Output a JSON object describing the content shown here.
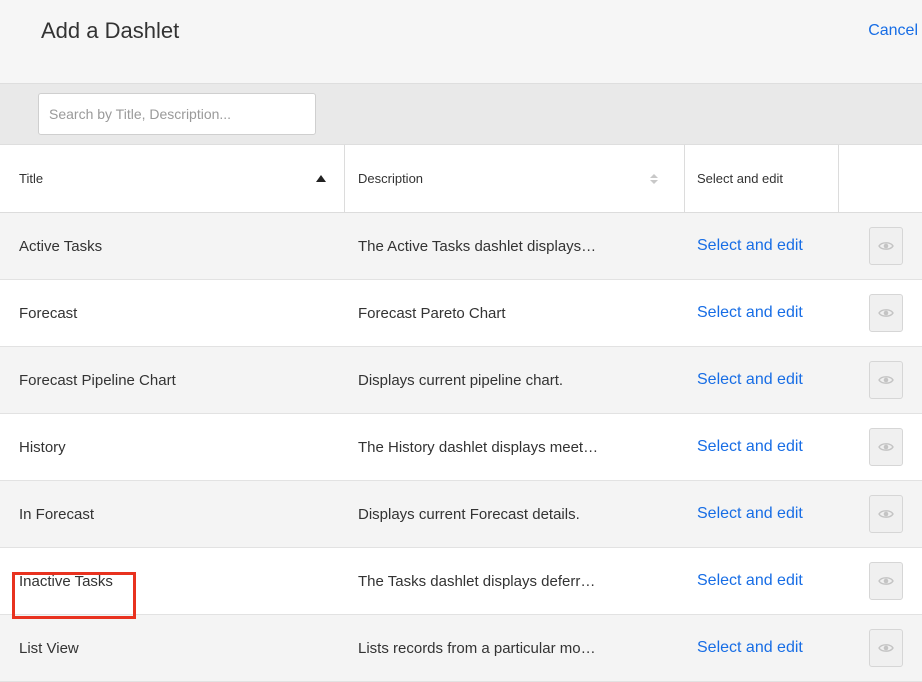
{
  "header": {
    "title": "Add a Dashlet",
    "cancel_label": "Cancel"
  },
  "search": {
    "placeholder": "Search by Title, Description..."
  },
  "table": {
    "columns": {
      "title": "Title",
      "description": "Description",
      "select": "Select and edit"
    },
    "sort": {
      "column": "title",
      "direction": "ascending"
    },
    "rows": [
      {
        "title": "Active Tasks",
        "description": "The Active Tasks dashlet displays…",
        "action": "Select and edit"
      },
      {
        "title": "Forecast",
        "description": "Forecast Pareto Chart",
        "action": "Select and edit"
      },
      {
        "title": "Forecast Pipeline Chart",
        "description": "Displays current pipeline chart.",
        "action": "Select and edit"
      },
      {
        "title": "History",
        "description": "The History dashlet displays meet…",
        "action": "Select and edit"
      },
      {
        "title": "In Forecast",
        "description": "Displays current Forecast details.",
        "action": "Select and edit"
      },
      {
        "title": "Inactive Tasks",
        "description": "The Tasks dashlet displays deferr…",
        "action": "Select and edit"
      },
      {
        "title": "List View",
        "description": "Lists records from a particular mo…",
        "action": "Select and edit"
      }
    ],
    "preview_icon": "eye-icon"
  },
  "annotation": {
    "highlighted_row": "List View",
    "color": "#e8321f"
  },
  "colors": {
    "link": "#176de5",
    "header_bg": "#f6f6f6",
    "searchbar_bg": "#e9e9e9"
  }
}
